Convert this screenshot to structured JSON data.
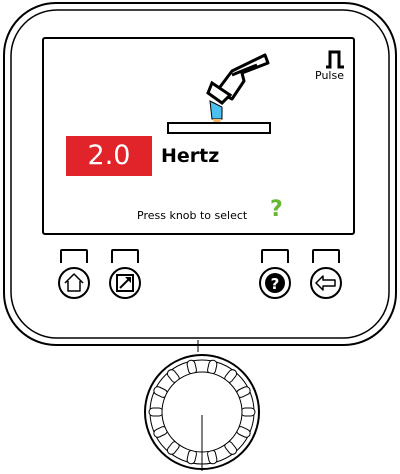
{
  "display": {
    "value": "2.0",
    "unit": "Hertz",
    "mode_label": "Pulse",
    "hint_text": "Press knob to select",
    "hint_symbol": "?"
  },
  "buttons": {
    "help_glyph": "?"
  },
  "colors": {
    "value_bg": "#e0242a",
    "hint_accent": "#66b832",
    "torch_nozzle": "#4cc0f0",
    "arc": "#f4b860"
  },
  "icons": {
    "mode": "pulse-waveform-icon",
    "torch": "welding-torch-icon",
    "home": "home-icon",
    "expand": "expand-arrow-icon",
    "help": "help-icon",
    "back": "back-arrow-icon",
    "knob": "control-knob"
  }
}
